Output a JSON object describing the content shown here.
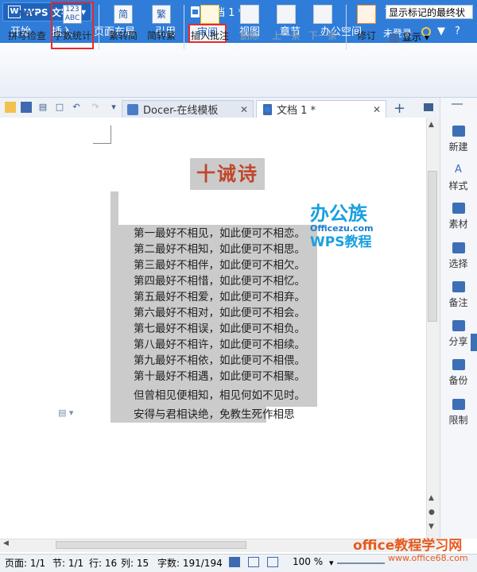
{
  "app": {
    "name": "WPS 文字",
    "logo_letter": "W",
    "doc_title": "文档 1 *"
  },
  "window_buttons": {
    "minimize": "—",
    "maximize": "▭",
    "close": "✕",
    "collapse": "⌃"
  },
  "menu": {
    "items": [
      "开始",
      "插入",
      "页面布局",
      "引用",
      "审阅",
      "视图",
      "章节",
      "办公空间"
    ],
    "active": "审阅",
    "login": "未登录",
    "help": "?"
  },
  "ribbon": {
    "spellcheck": {
      "label": "拼写检查",
      "icon_text": "ABC"
    },
    "wordcount": {
      "label": "字数统计",
      "icon_text": "123 ABC"
    },
    "to_simplified": {
      "label": "繁转简",
      "icon_text": "简"
    },
    "to_traditional": {
      "label": "简转繁",
      "icon_text": "繁"
    },
    "insert_comment": {
      "label": "插入批注"
    },
    "delete": {
      "label": "删除"
    },
    "prev": {
      "label": "上一条"
    },
    "next": {
      "label": "下一条"
    },
    "revise": {
      "label": "修订"
    },
    "show": {
      "label": "显示"
    },
    "markup_select": "显示标记的最终状"
  },
  "tabs": [
    {
      "label": "Docer-在线模板",
      "close": "✕"
    },
    {
      "label": "文档 1 *",
      "close": "✕"
    }
  ],
  "new_tab": "+",
  "document": {
    "title": "十诫诗",
    "lines": [
      "第一最好不相见，如此便可不相恋。",
      "第二最好不相知，如此便可不相思。",
      "第三最好不相伴，如此便可不相欠。",
      "第四最好不相惜，如此便可不相忆。",
      "第五最好不相爱，如此便可不相弃。",
      "第六最好不相对，如此便可不相会。",
      "第七最好不相误，如此便可不相负。",
      "第八最好不相许，如此便可不相续。",
      "第九最好不相依，如此便可不相偎。",
      "第十最好不相遇，如此便可不相聚。",
      "但曾相见便相知，相见何如不见时。",
      "安得与君相诀绝，免教生死作相思"
    ],
    "watermark": {
      "brand": "办公族",
      "url": "Officezu.com",
      "sub": "WPS教程"
    }
  },
  "right_panel": [
    "新建",
    "样式",
    "素材",
    "选择",
    "备注",
    "分享",
    "备份",
    "限制"
  ],
  "status": {
    "page": "页面: 1/1",
    "section": "节: 1/1",
    "line": "行: 16",
    "column": "列: 15",
    "wordcount": "字数: 191/194",
    "zoom": "100 %"
  },
  "site_watermark": {
    "title": "office教程学习网",
    "url": "www.office68.com"
  }
}
